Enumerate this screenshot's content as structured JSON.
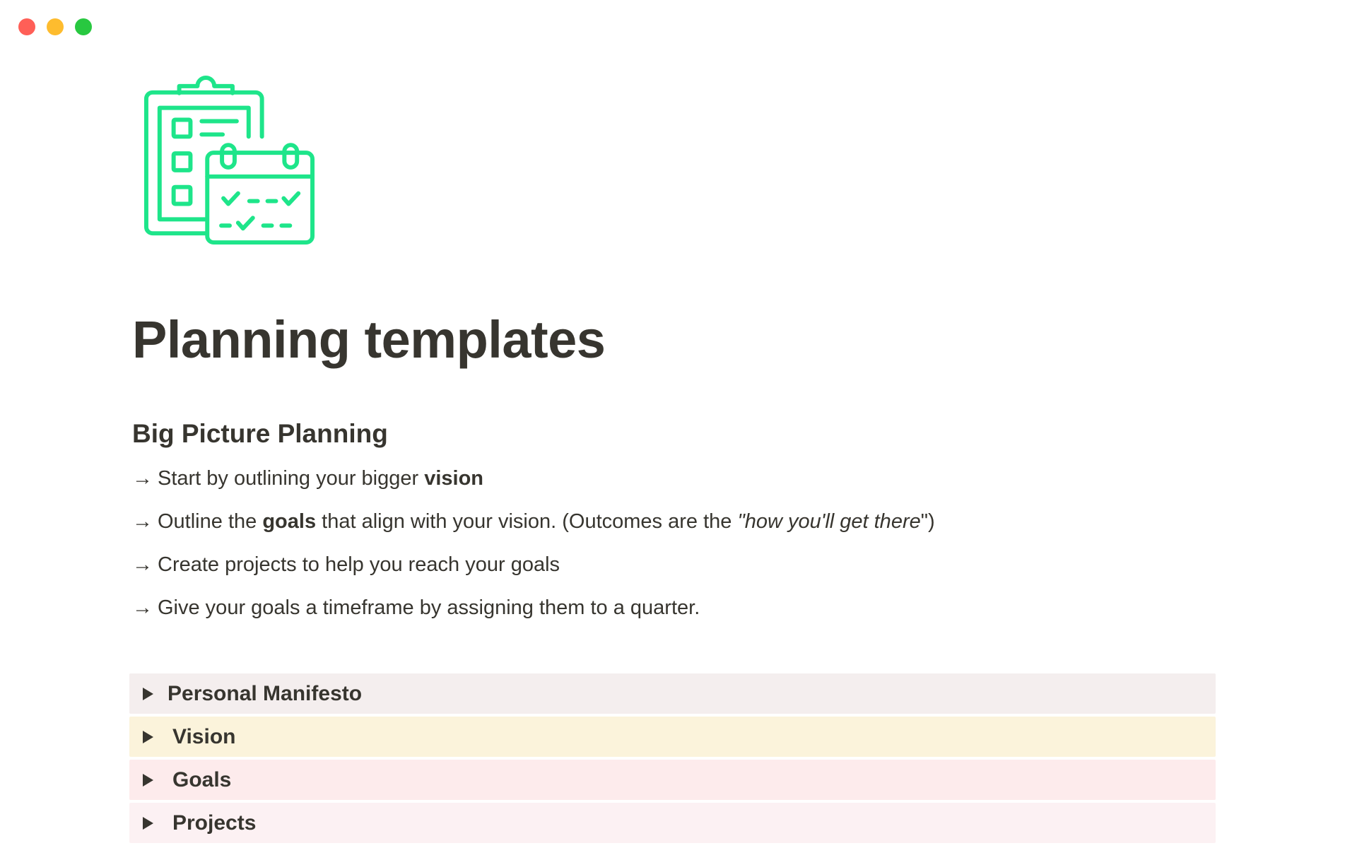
{
  "window": {
    "controls": {
      "close_color": "#ff5f57",
      "minimize_color": "#febc2e",
      "zoom_color": "#28c840"
    }
  },
  "page": {
    "icon": "clipboard-calendar-checklist-icon",
    "icon_color": "#1ee58a",
    "title": "Planning templates"
  },
  "section": {
    "heading": "Big Picture Planning",
    "bullets": [
      {
        "arrow": "→",
        "parts": [
          {
            "text": "Start by outlining your bigger ",
            "style": "normal"
          },
          {
            "text": "vision",
            "style": "bold"
          }
        ]
      },
      {
        "arrow": "→",
        "parts": [
          {
            "text": "Outline the ",
            "style": "normal"
          },
          {
            "text": "goals",
            "style": "bold"
          },
          {
            "text": " that align with your vision. (Outcomes are the ",
            "style": "normal"
          },
          {
            "text": "\"how you'll get there",
            "style": "italic"
          },
          {
            "text": "\")",
            "style": "normal"
          }
        ]
      },
      {
        "arrow": "→",
        "parts": [
          {
            "text": "Create projects to help you reach your goals",
            "style": "normal"
          }
        ]
      },
      {
        "arrow": "→",
        "parts": [
          {
            "text": "Give your goals a timeframe by assigning them to a quarter.",
            "style": "normal"
          }
        ]
      }
    ]
  },
  "toggles": [
    {
      "label": "Personal Manifesto",
      "bg": "#f4eeee"
    },
    {
      "label": "Vision",
      "bg": "#fbf3db"
    },
    {
      "label": "Goals",
      "bg": "#fdebec"
    },
    {
      "label": "Projects",
      "bg": "#fcf1f3"
    }
  ]
}
